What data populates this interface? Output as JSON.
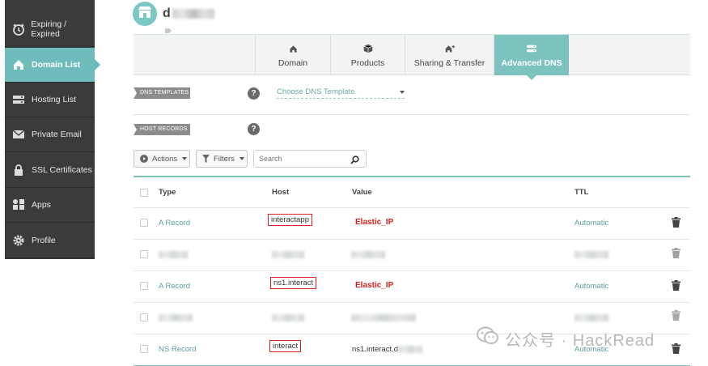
{
  "sidebar": {
    "items": [
      {
        "label": "Expiring / Expired",
        "icon": "clock-icon",
        "active": false
      },
      {
        "label": "Domain List",
        "icon": "home-icon",
        "active": true
      },
      {
        "label": "Hosting List",
        "icon": "server-icon",
        "active": false
      },
      {
        "label": "Private Email",
        "icon": "envelope-icon",
        "active": false
      },
      {
        "label": "SSL Certificates",
        "icon": "lock-icon",
        "active": false
      },
      {
        "label": "Apps",
        "icon": "apps-icon",
        "active": false
      },
      {
        "label": "Profile",
        "icon": "gear-icon",
        "active": false
      }
    ]
  },
  "header": {
    "domain_initial": "d"
  },
  "tabs": [
    {
      "label": "Domain",
      "icon": "home-icon",
      "active": false
    },
    {
      "label": "Products",
      "icon": "box-icon",
      "active": false
    },
    {
      "label": "Sharing & Transfer",
      "icon": "share-home-icon",
      "active": false
    },
    {
      "label": "Advanced DNS",
      "icon": "dns-icon",
      "active": true
    }
  ],
  "dns_templates": {
    "label": "DNS TEMPLATES",
    "help": "?",
    "select_value": "Choose DNS Template"
  },
  "host_records": {
    "label": "HOST RECORDS",
    "help": "?"
  },
  "toolbar": {
    "actions_label": "Actions",
    "filters_label": "Filters",
    "search_placeholder": "Search"
  },
  "table": {
    "headers": {
      "type": "Type",
      "host": "Host",
      "value": "Value",
      "ttl": "TTL"
    },
    "rows": [
      {
        "type": "A Record",
        "host": "interactapp",
        "value": "Elastic_IP",
        "ttl": "Automatic"
      },
      {
        "type": "",
        "host": "",
        "value": "",
        "ttl": ""
      },
      {
        "type": "A Record",
        "host": "ns1.interact",
        "value": "Elastic_IP",
        "ttl": "Automatic"
      },
      {
        "type": "",
        "host": "",
        "value": "",
        "ttl": ""
      },
      {
        "type": "NS Record",
        "host": "interact",
        "value": "ns1.interact.d",
        "ttl": "Automatic"
      }
    ]
  },
  "watermark": {
    "text": "公众号 · HackRead"
  },
  "colors": {
    "accent": "#7cc2bf",
    "sidebar_bg": "#3b3b3b",
    "highlight_red": "#e02020",
    "link_teal": "#5c9fa0"
  }
}
